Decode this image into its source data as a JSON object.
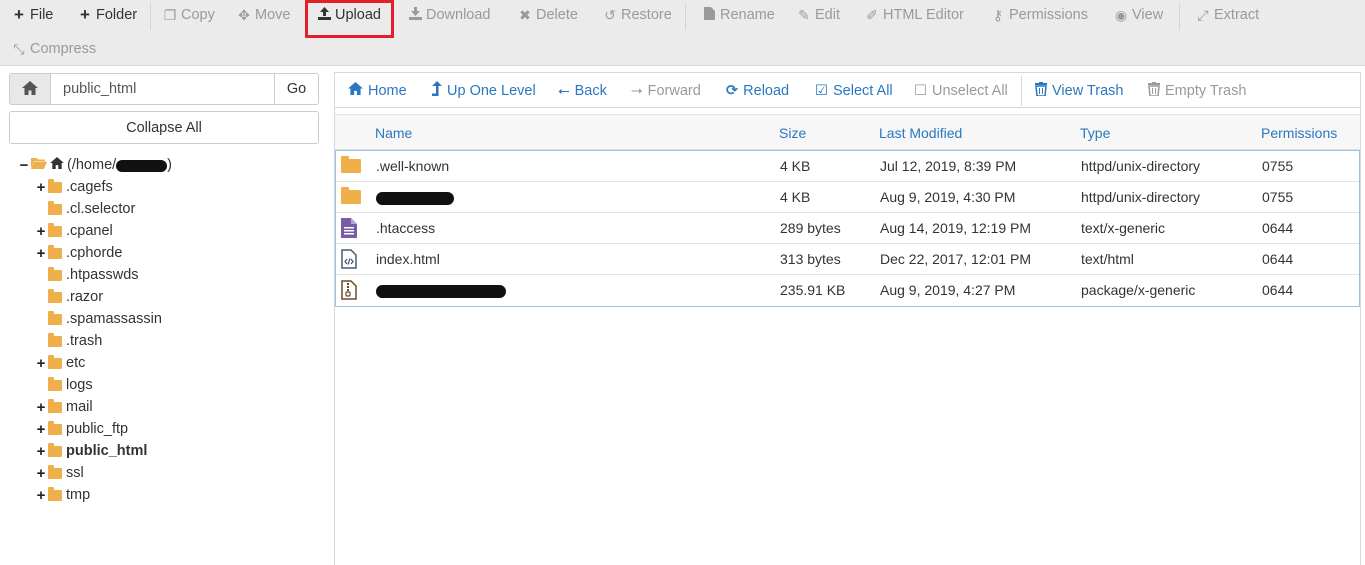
{
  "toolbar": {
    "buttons": [
      {
        "label": "File",
        "icon": "plus-icon",
        "enabled": true
      },
      {
        "label": "Folder",
        "icon": "plus-icon",
        "enabled": true
      },
      {
        "label": "Copy",
        "icon": "copy-icon",
        "enabled": false
      },
      {
        "label": "Move",
        "icon": "move-icon",
        "enabled": false
      },
      {
        "label": "Upload",
        "icon": "upload-icon",
        "enabled": true
      },
      {
        "label": "Download",
        "icon": "download-icon",
        "enabled": false
      },
      {
        "label": "Delete",
        "icon": "close-icon",
        "enabled": false
      },
      {
        "label": "Restore",
        "icon": "undo-icon",
        "enabled": false
      },
      {
        "label": "Rename",
        "icon": "file-icon",
        "enabled": false
      },
      {
        "label": "Edit",
        "icon": "pencil-icon",
        "enabled": false
      },
      {
        "label": "HTML Editor",
        "icon": "edit-square-icon",
        "enabled": false
      },
      {
        "label": "Permissions",
        "icon": "key-icon",
        "enabled": false
      },
      {
        "label": "View",
        "icon": "eye-icon",
        "enabled": false
      },
      {
        "label": "Extract",
        "icon": "expand-icon",
        "enabled": false
      },
      {
        "label": "Compress",
        "icon": "compress-icon",
        "enabled": false
      }
    ],
    "highlight_color": "#e0202a"
  },
  "sidebar": {
    "path_value": "public_html",
    "go_label": "Go",
    "collapse_label": "Collapse All",
    "root_label_prefix": "(/home/",
    "root_label_suffix": ")",
    "items": [
      {
        "label": ".cagefs",
        "expandable": true
      },
      {
        "label": ".cl.selector",
        "expandable": false
      },
      {
        "label": ".cpanel",
        "expandable": true
      },
      {
        "label": ".cphorde",
        "expandable": true
      },
      {
        "label": ".htpasswds",
        "expandable": false
      },
      {
        "label": ".razor",
        "expandable": false
      },
      {
        "label": ".spamassassin",
        "expandable": false
      },
      {
        "label": ".trash",
        "expandable": false
      },
      {
        "label": "etc",
        "expandable": true
      },
      {
        "label": "logs",
        "expandable": false
      },
      {
        "label": "mail",
        "expandable": true
      },
      {
        "label": "public_ftp",
        "expandable": true
      },
      {
        "label": "public_html",
        "expandable": true,
        "current": true
      },
      {
        "label": "ssl",
        "expandable": true
      },
      {
        "label": "tmp",
        "expandable": true
      }
    ]
  },
  "nav": {
    "buttons": [
      {
        "label": "Home",
        "icon": "home-icon",
        "enabled": true
      },
      {
        "label": "Up One Level",
        "icon": "level-up-icon",
        "enabled": true
      },
      {
        "label": "Back",
        "icon": "arrow-left-icon",
        "enabled": true
      },
      {
        "label": "Forward",
        "icon": "arrow-right-icon",
        "enabled": false
      },
      {
        "label": "Reload",
        "icon": "refresh-icon",
        "enabled": true
      },
      {
        "label": "Select All",
        "icon": "checkbox-checked-icon",
        "enabled": true
      },
      {
        "label": "Unselect All",
        "icon": "checkbox-empty-icon",
        "enabled": false
      },
      {
        "label": "View Trash",
        "icon": "trash-icon",
        "enabled": true
      },
      {
        "label": "Empty Trash",
        "icon": "trash-icon",
        "enabled": false
      }
    ]
  },
  "files": {
    "headers": {
      "name": "Name",
      "size": "Size",
      "modified": "Last Modified",
      "type": "Type",
      "permissions": "Permissions"
    },
    "rows": [
      {
        "icon": "folder-icon",
        "name": ".well-known",
        "size": "4 KB",
        "modified": "Jul 12, 2019, 8:39 PM",
        "type": "httpd/unix-directory",
        "permissions": "0755"
      },
      {
        "icon": "folder-icon",
        "name": "",
        "redacted": true,
        "size": "4 KB",
        "modified": "Aug 9, 2019, 4:30 PM",
        "type": "httpd/unix-directory",
        "permissions": "0755"
      },
      {
        "icon": "text-file-icon",
        "name": ".htaccess",
        "size": "289 bytes",
        "modified": "Aug 14, 2019, 12:19 PM",
        "type": "text/x-generic",
        "permissions": "0644"
      },
      {
        "icon": "code-file-icon",
        "name": "index.html",
        "size": "313 bytes",
        "modified": "Dec 22, 2017, 12:01 PM",
        "type": "text/html",
        "permissions": "0644"
      },
      {
        "icon": "archive-file-icon",
        "name": "",
        "redacted": true,
        "size": "235.91 KB",
        "modified": "Aug 9, 2019, 4:27 PM",
        "type": "package/x-generic",
        "permissions": "0644"
      }
    ]
  }
}
